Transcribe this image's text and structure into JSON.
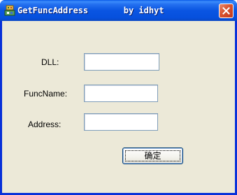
{
  "window": {
    "title": "GetFuncAddress       by idhyt",
    "close_icon": "close-icon",
    "app_icon": "app-icon"
  },
  "form": {
    "dll": {
      "label": "DLL:",
      "value": ""
    },
    "funcname": {
      "label": "FuncName:",
      "value": ""
    },
    "address": {
      "label": "Address:",
      "value": ""
    }
  },
  "buttons": {
    "ok_label": "确定"
  },
  "colors": {
    "titlebar": "#0a55e2",
    "client_bg": "#ece9d8",
    "close_red": "#d8532f",
    "field_border": "#7f9db9"
  }
}
